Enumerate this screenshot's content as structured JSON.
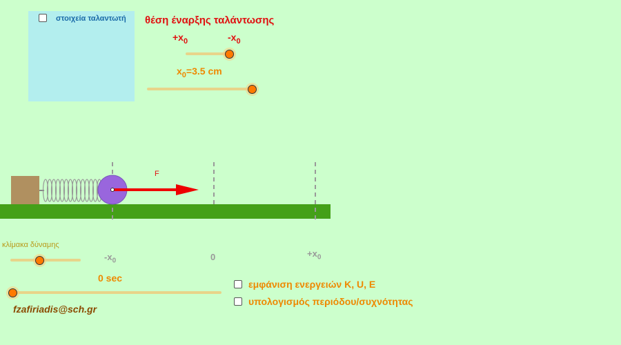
{
  "info_panel": {
    "checkbox_label": "στοιχεία ταλαντωτή",
    "checked": false
  },
  "start_position": {
    "title": "θέση έναρξης ταλάντωσης",
    "left_label": "+x",
    "left_sub": "0",
    "right_label": "-x",
    "right_sub": "0",
    "slider_value": 1
  },
  "amplitude": {
    "label_x": "x",
    "label_sub": "0",
    "label_value": "=3.5 cm",
    "slider_value": 1
  },
  "diagram": {
    "force_label": "F",
    "axis_labels": [
      {
        "text": "-x",
        "sub": "0"
      },
      {
        "text": "0",
        "sub": ""
      },
      {
        "text": "+x",
        "sub": "0"
      }
    ]
  },
  "force_scale": {
    "label": "κλίμακα δύναμης",
    "slider_value": 0.45
  },
  "time": {
    "label": "0 sec",
    "slider_value": 0
  },
  "options": [
    {
      "label": "εμφάνιση ενεργειών K, U, E",
      "checked": false
    },
    {
      "label": "υπολογισμός περιόδου/συχνότητας",
      "checked": false
    }
  ],
  "author_email": "fzafiriadis@sch.gr",
  "colors": {
    "background": "#ccffcc",
    "ground": "#44a018",
    "ball": "#9966dd",
    "arrow": "#ee0000",
    "block": "#b09060"
  }
}
